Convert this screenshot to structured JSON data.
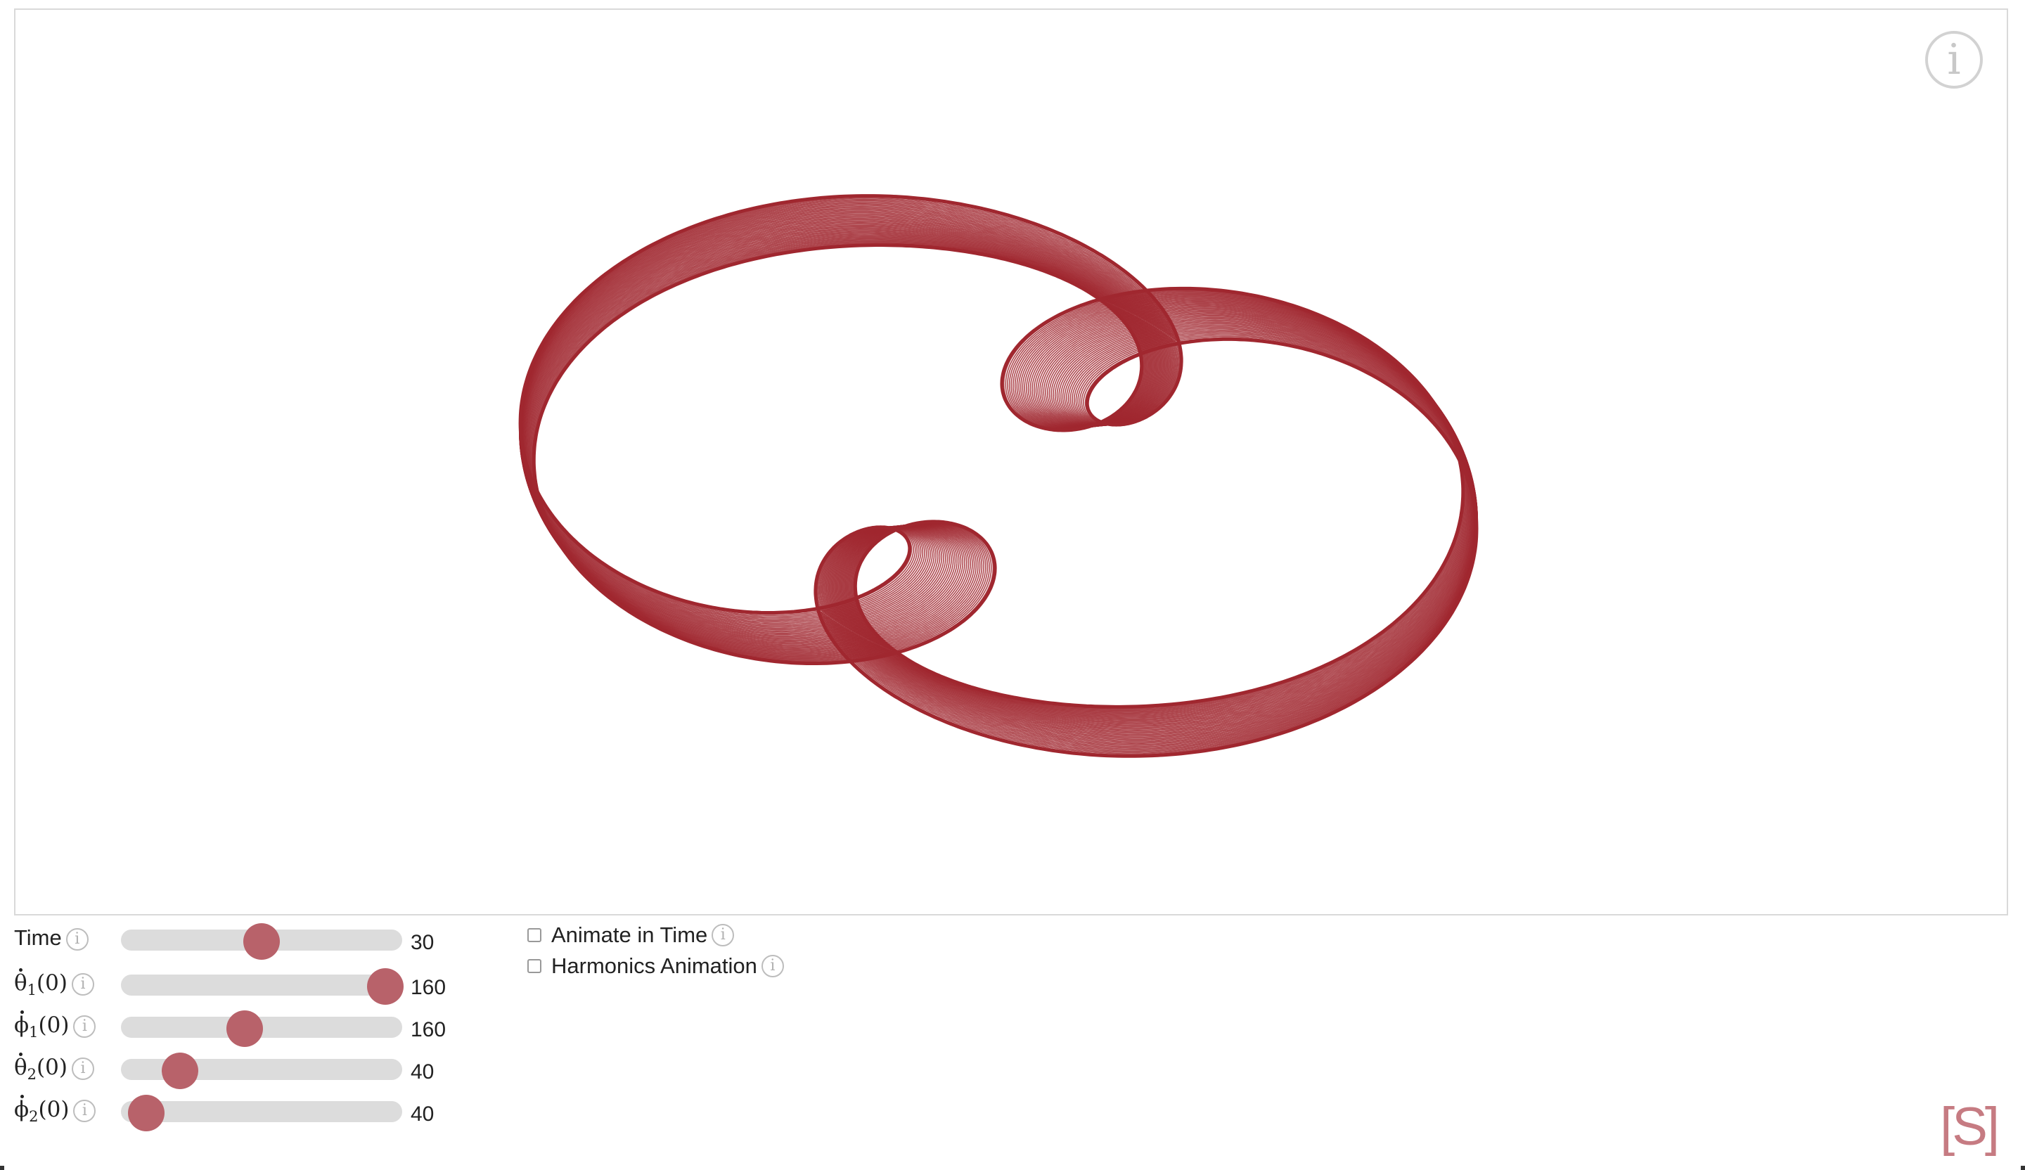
{
  "colors": {
    "curve": "#a0272f",
    "thumb": "#b8626a",
    "track": "#dcdcdc",
    "brand": "#c67b82"
  },
  "icons": {
    "info_big": "info-icon",
    "info_small": "info-icon",
    "brand": "s-bracket-logo"
  },
  "glyphs": {
    "info": "i"
  },
  "sliders": [
    {
      "id": "time",
      "label": "Time",
      "value": "30",
      "fraction": 0.5
    },
    {
      "id": "theta1",
      "symbol": "θ",
      "sub": "1",
      "arg": "(0)",
      "value": "160",
      "fraction": 0.94
    },
    {
      "id": "phi1",
      "symbol": "ϕ",
      "sub": "1",
      "arg": "(0)",
      "value": "160",
      "fraction": 0.44
    },
    {
      "id": "theta2",
      "symbol": "θ",
      "sub": "2",
      "arg": "(0)",
      "value": "40",
      "fraction": 0.21
    },
    {
      "id": "phi2",
      "symbol": "ϕ",
      "sub": "2",
      "arg": "(0)",
      "value": "40",
      "fraction": 0.09
    }
  ],
  "checkboxes": [
    {
      "label": "Animate in Time",
      "checked": false
    },
    {
      "label": "Harmonics Animation",
      "checked": false
    }
  ],
  "brand": "[S]"
}
